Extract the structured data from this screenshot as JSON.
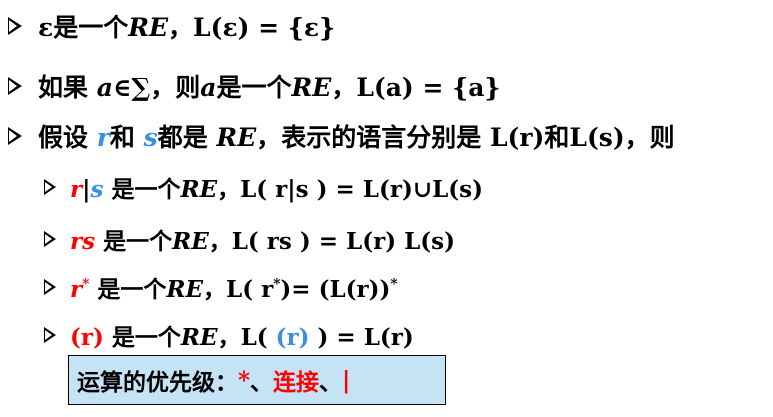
{
  "lines": [
    {
      "pre": "ε是一个",
      "re": "RE",
      "post": "，L(ε) = {ε}"
    },
    {
      "pre": "如果 ",
      "a": "a",
      "mid": "∈∑，则",
      "a2": "a",
      "mid2": "是一个",
      "re": "RE",
      "post": "，L(a) = {a}"
    },
    {
      "pre": "假设 ",
      "r": "r",
      "and": "和 ",
      "s": "s",
      "mid": "都是 ",
      "re": "RE",
      "post": "，表示的语言分别是 L(r)和L(s)，则"
    }
  ],
  "sub": [
    {
      "expr_r": "r",
      "pipe": "|",
      "expr_s": "s",
      "text1": " 是一个",
      "re": "RE",
      "text2": "，L( r|s ) = L(r)∪L(s)"
    },
    {
      "expr": "rs",
      "text1": "  是一个",
      "re": "RE",
      "text2": "，L( rs ) = L(r) L(s)"
    },
    {
      "expr": "r",
      "star": "*",
      "text1": "  是一个",
      "re": "RE",
      "text2a": "，L( r",
      "star2": "*",
      "text2b": ")= (L(r))",
      "star3": "*"
    },
    {
      "expr": "(r)",
      "text1": " 是一个",
      "re": "RE",
      "text2a": "，L( ",
      "paren": "(r)",
      "text2b": " ) = L(r)"
    }
  ],
  "precedence": {
    "label": "运算的优先级：",
    "op1": "*",
    "sep1": "、",
    "op2": "连接",
    "sep2": "、",
    "op3": "|"
  },
  "colors": {
    "red": "#ff0000",
    "blue": "#3b8fe0",
    "box_fill": "#c6e2f5"
  }
}
